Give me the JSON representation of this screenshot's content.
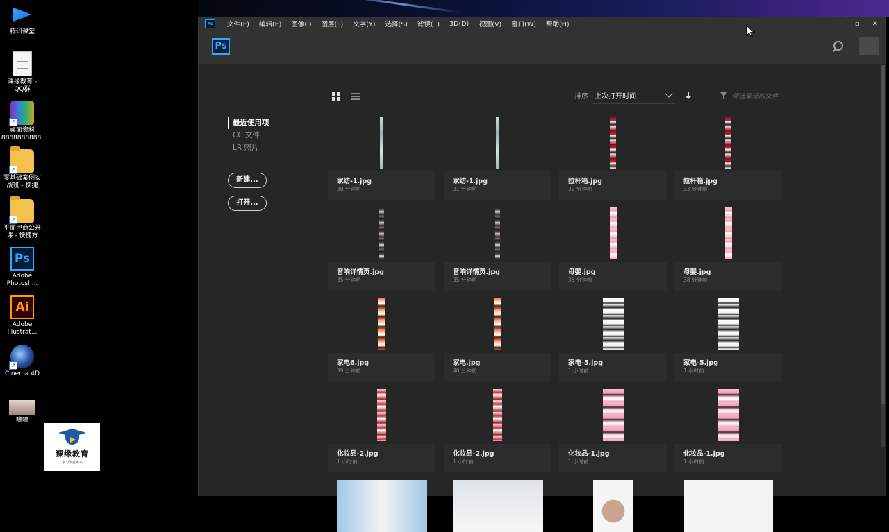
{
  "desktop": {
    "icons": [
      {
        "label": "腾讯课堂",
        "icon": "tencent-classroom-icon"
      },
      {
        "label": "课缘教育 -QQ群",
        "icon": "document-icon"
      },
      {
        "label": "桌面资料 8888888888...",
        "icon": "rar-archive-icon"
      },
      {
        "label": "零基础案例实战班 - 快捷",
        "icon": "folder-icon"
      },
      {
        "label": "平面电商公开课 - 快捷方",
        "icon": "folder-icon"
      },
      {
        "label": "Adobe Photosh...",
        "icon": "photoshop-icon",
        "glyph": "Ps"
      },
      {
        "label": "Adobe Illustrat...",
        "icon": "illustrator-icon",
        "glyph": "Ai"
      },
      {
        "label": "Cinema 4D",
        "icon": "cinema4d-icon"
      },
      {
        "label": "嘀嘀",
        "icon": "photo-icon"
      }
    ],
    "brand": {
      "name": "课缘教育",
      "tagline": "学习改变未来"
    }
  },
  "window": {
    "app_badge": "Ps",
    "menus": [
      "文件(F)",
      "编辑(E)",
      "图像(I)",
      "图层(L)",
      "文字(Y)",
      "选择(S)",
      "滤镜(T)",
      "3D(D)",
      "视图(V)",
      "窗口(W)",
      "帮助(H)"
    ],
    "controls": {
      "minimize": "–",
      "maximize": "▫",
      "close": "✕"
    }
  },
  "header": {
    "logo": "Ps"
  },
  "sidebar": {
    "items": [
      {
        "label": "最近使用项"
      },
      {
        "label": "CC 文件"
      },
      {
        "label": "LR 照片"
      }
    ],
    "new_button": "新建...",
    "open_button": "打开..."
  },
  "toolbar": {
    "sort_label": "排序",
    "sort_value": "上次打开时间",
    "filter_placeholder": "筛选最近的文件"
  },
  "files": [
    {
      "name": "家纺-1.jpg",
      "time": "30 分钟前",
      "thumb": "white-strip"
    },
    {
      "name": "家纺-1.jpg",
      "time": "31 分钟前",
      "thumb": "white-strip"
    },
    {
      "name": "拉杆箱.jpg",
      "time": "32 分钟前",
      "thumb": "red-strip"
    },
    {
      "name": "拉杆箱.jpg",
      "time": "33 分钟前",
      "thumb": "red-strip"
    },
    {
      "name": "音响详情页.jpg",
      "time": "35 分钟前",
      "thumb": "dark-strip"
    },
    {
      "name": "音响详情页.jpg",
      "time": "35 分钟前",
      "thumb": "dark-strip"
    },
    {
      "name": "母婴.jpg",
      "time": "35 分钟前",
      "thumb": "pink-strip"
    },
    {
      "name": "母婴.jpg",
      "time": "38 分钟前",
      "thumb": "pink-strip"
    },
    {
      "name": "家电6.jpg",
      "time": "39 分钟前",
      "thumb": "orange-strip"
    },
    {
      "name": "家电.jpg",
      "time": "40 分钟前",
      "thumb": "orange-strip"
    },
    {
      "name": "家电-5.jpg",
      "time": "1 小时前",
      "thumb": "appliance"
    },
    {
      "name": "家电-5.jpg",
      "time": "1 小时前",
      "thumb": "appliance"
    },
    {
      "name": "化妆品-2.jpg",
      "time": "1 小时前",
      "thumb": "cosm-red"
    },
    {
      "name": "化妆品-2.jpg",
      "time": "1 小时前",
      "thumb": "cosm-red"
    },
    {
      "name": "化妆品-1.jpg",
      "time": "1 小时前",
      "thumb": "cosm-pink"
    },
    {
      "name": "化妆品-1.jpg",
      "time": "1 小时前",
      "thumb": "cosm-pink"
    },
    {
      "name": "",
      "time": "",
      "thumb": "bottom-1"
    },
    {
      "name": "",
      "time": "",
      "thumb": "bottom-2"
    },
    {
      "name": "",
      "time": "",
      "thumb": "bottom-3"
    },
    {
      "name": "",
      "time": "",
      "thumb": "bottom-4"
    }
  ],
  "colors": {
    "ps_blue": "#31a8ff",
    "ai_orange": "#ff9a00",
    "panel_bg": "#262626",
    "card_bg": "#2c2c2c"
  }
}
